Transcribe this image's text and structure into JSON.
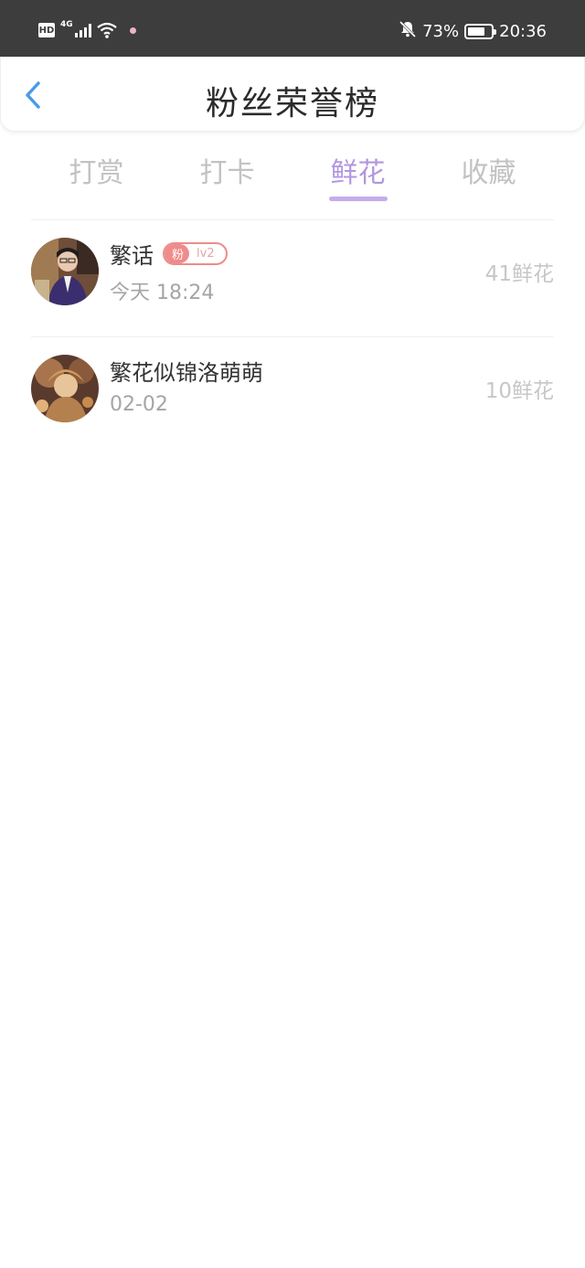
{
  "status_bar": {
    "hd": "HD",
    "network": "4G",
    "battery_percent": "73%",
    "battery_level": 0.73,
    "time": "20:36"
  },
  "header": {
    "title": "粉丝荣誉榜",
    "back_icon": "chevron-left-icon"
  },
  "tabs": [
    {
      "label": "打赏",
      "active": false
    },
    {
      "label": "打卡",
      "active": false
    },
    {
      "label": "鲜花",
      "active": true
    },
    {
      "label": "收藏",
      "active": false
    }
  ],
  "accent_color": "#b197e0",
  "fans": [
    {
      "name": "繁话",
      "badge_tag": "粉",
      "badge_level": "lv2",
      "time": "今天 18:24",
      "amount": "41鲜花"
    },
    {
      "name": "繁花似锦洛萌萌",
      "time": "02-02",
      "amount": "10鲜花"
    }
  ]
}
